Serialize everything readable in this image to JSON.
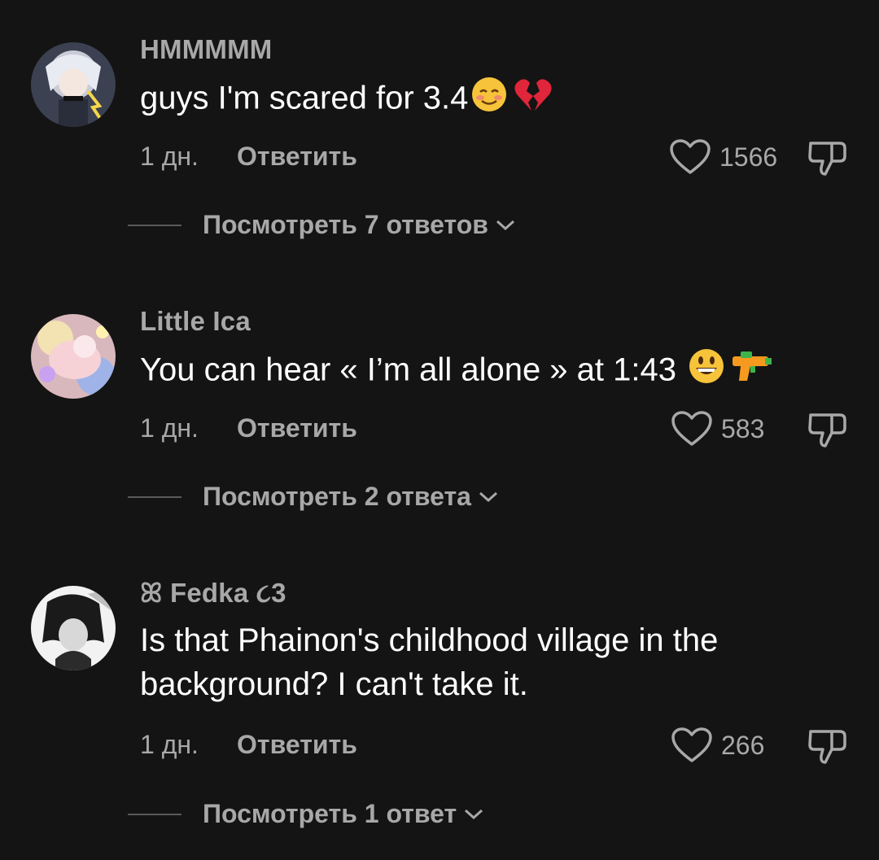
{
  "comments": [
    {
      "username": "HMMMMM",
      "text": "guys I'm scared for 3.4",
      "emojis": [
        "smiling-face-emoji",
        "broken-heart-emoji"
      ],
      "time": "1 дн.",
      "reply_label": "Ответить",
      "likes": "1566",
      "view_replies": "Посмотреть 7 ответов"
    },
    {
      "username": "Little Ica",
      "text": "You can hear « I’m all alone » at 1:43",
      "emojis": [
        "grinning-face-emoji",
        "water-pistol-emoji"
      ],
      "time": "1 дн.",
      "reply_label": "Ответить",
      "likes": "583",
      "view_replies": "Посмотреть 2 ответа"
    },
    {
      "username": "ꕤ Fedka ૮3",
      "text_line1": "Is that Phainon's childhood village in the",
      "text_line2": "background? I can't take it.",
      "time": "1 дн.",
      "reply_label": "Ответить",
      "likes": "266",
      "view_replies": "Посмотреть 1 ответ"
    }
  ],
  "colors": {
    "background": "#141414",
    "secondary_text": "#a8a8a8",
    "primary_text": "#ffffff"
  }
}
